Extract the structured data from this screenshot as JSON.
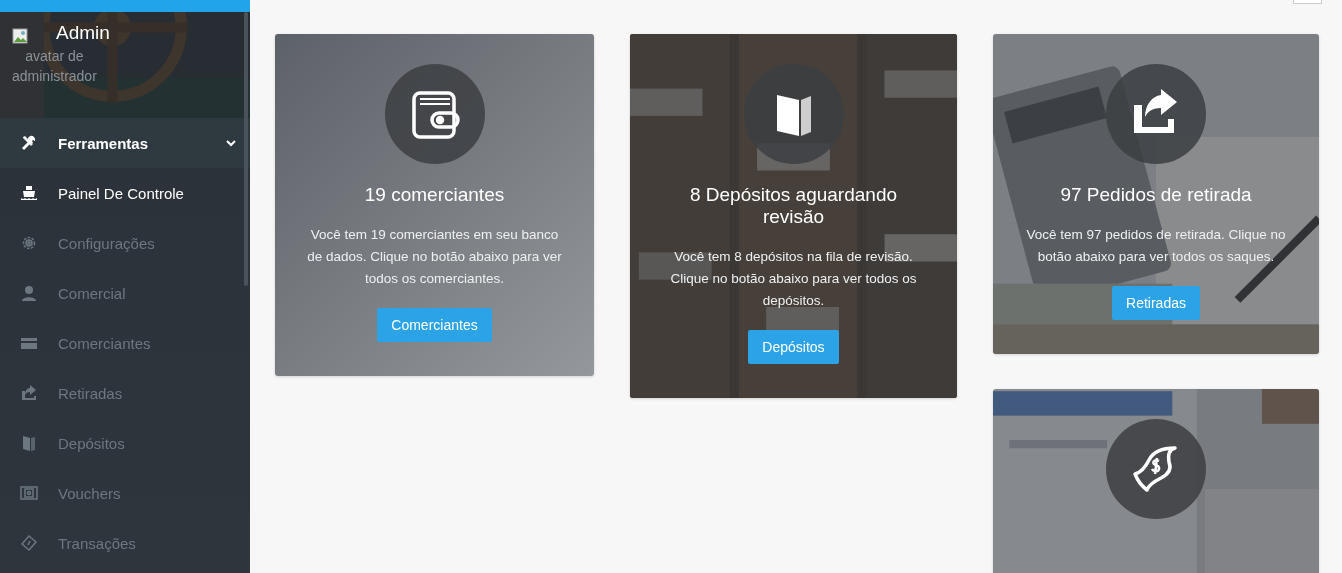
{
  "sidebar": {
    "avatar_alt": "avatar de administrador",
    "user_name": "Admin",
    "items": [
      {
        "label": "Ferramentas",
        "kind": "group",
        "expanded": true
      },
      {
        "label": "Painel De Controle",
        "kind": "link",
        "selected": true
      },
      {
        "label": "Configurações",
        "kind": "link",
        "selected": false
      },
      {
        "label": "Comercial",
        "kind": "link",
        "selected": false
      },
      {
        "label": "Comerciantes",
        "kind": "link",
        "selected": false
      },
      {
        "label": "Retiradas",
        "kind": "link",
        "selected": false
      },
      {
        "label": "Depósitos",
        "kind": "link",
        "selected": false
      },
      {
        "label": "Vouchers",
        "kind": "link",
        "selected": false
      },
      {
        "label": "Transações",
        "kind": "link",
        "selected": false
      }
    ]
  },
  "cards": [
    {
      "kind": "plain",
      "title": "19 comerciantes",
      "text": "Você tem 19 comerciantes em seu banco de dados. Clique no botão abaixo para ver todos os comerciantes.",
      "button": "Comerciantes"
    },
    {
      "kind": "picture",
      "title": "8 Depósitos aguardando revisão",
      "text": "Você tem 8 depósitos na fila de revisão. Clique no botão abaixo para ver todos os depósitos.",
      "button": "Depósitos"
    },
    {
      "kind": "picture",
      "title": "97 Pedidos de retirada",
      "text": "Você tem 97 pedidos de retirada. Clique no botão abaixo para ver todos os saques.",
      "button": "Retiradas"
    },
    {
      "kind": "picture"
    }
  ]
}
